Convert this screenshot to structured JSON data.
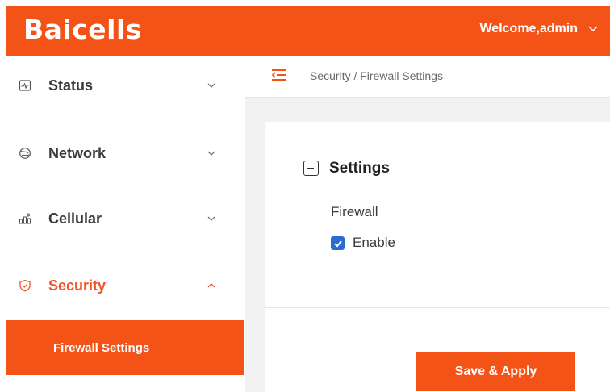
{
  "colors": {
    "brand": "#f45317",
    "active_text": "#f0562a",
    "checkbox": "#2b6cd3"
  },
  "header": {
    "logo_text": "Baicells",
    "welcome_text": "Welcome,admin",
    "welcome_icon": "chevron-down-icon"
  },
  "sidebar": {
    "items": [
      {
        "label": "Status",
        "icon": "status-monitor-icon",
        "expanded": false
      },
      {
        "label": "Network",
        "icon": "network-globe-icon",
        "expanded": false
      },
      {
        "label": "Cellular",
        "icon": "cellular-tower-icon",
        "expanded": false
      },
      {
        "label": "Security",
        "icon": "shield-check-icon",
        "expanded": true
      }
    ],
    "submenu": {
      "label": "Firewall Settings",
      "active": true
    }
  },
  "breadcrumb": {
    "text": "Security / Firewall Settings",
    "toggle_icon": "menu-collapse-icon"
  },
  "settings": {
    "title": "Settings",
    "firewall_label": "Firewall",
    "enable_label": "Enable",
    "enable_checked": true
  },
  "actions": {
    "save_label": "Save & Apply"
  }
}
